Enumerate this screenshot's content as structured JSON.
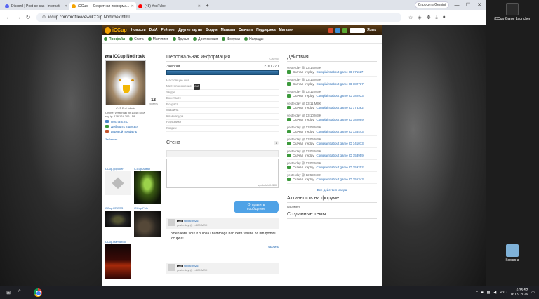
{
  "browser": {
    "tabs": [
      {
        "title": "Discord | Post-se-sas | Internati",
        "color": "#5865f2",
        "active": false
      },
      {
        "title": "iCCup — Секретная информа...",
        "color": "#f5a300",
        "active": true
      },
      {
        "title": "(48) YouTube",
        "color": "#ff0000",
        "active": false
      }
    ],
    "new_tab": "+",
    "gemini_label": "Спросить Gemini",
    "url": "iccup.com/profile/view/iCCup.Nodirbek.html"
  },
  "site": {
    "logo": "iCCup",
    "nav": [
      "Новости",
      "DotA",
      "Рейтинг",
      "Другие карты",
      "Форум",
      "Магазин",
      "Скачать",
      "Поддержка",
      "Магазин"
    ],
    "nav_right": {
      "lang": "Язык"
    },
    "subnav": [
      {
        "label": "Профайл",
        "active": true
      },
      {
        "label": "Стата",
        "active": false
      },
      {
        "label": "Матчлист",
        "active": false
      },
      {
        "label": "Друзья",
        "active": false
      },
      {
        "label": "Достижения",
        "active": false
      },
      {
        "label": "Форумы",
        "active": false
      },
      {
        "label": "Награды",
        "active": false
      }
    ]
  },
  "profile": {
    "username": "iCCup.Nodirbek",
    "tag": "CAT",
    "level_name": "CAT Full Admin",
    "rank": "12",
    "rank_label": "уровень",
    "last_online": "Online: yesterday @ 13:46 MSK",
    "reg_ip": "reg ip: 178.124.206.158",
    "links": {
      "message": "Послать ЛС",
      "add_friend": "Добавить в друзья",
      "game_profile": "Игровой профиль"
    },
    "ban_link": "Забанить"
  },
  "friends": [
    {
      "name": "iCCup.gopoker",
      "style": "heart"
    },
    {
      "name": "iCCup.Alisan",
      "style": "alien"
    },
    {
      "name": "iCCup.KROSS",
      "style": "dark"
    },
    {
      "name": "iCCup.Fols",
      "style": "smoke"
    },
    {
      "name": "iCCup.Hamtaroo",
      "style": "fire"
    }
  ],
  "personal": {
    "title": "Персональная информация",
    "status_label": "Статус",
    "energy_label": "Энергия",
    "energy_value": "270 / 270",
    "energy_fraction": 1.0,
    "fields": [
      "Настоящее имя",
      "Местоположение",
      "Skype",
      "Вконтакте",
      "Возраст",
      "Машина",
      "Клавиатура",
      "Наушники",
      "Коврик"
    ]
  },
  "wall": {
    "title": "Стена",
    "count": "1",
    "symbols": "symbols left: 300",
    "send_label": "Отправить сообщение",
    "posts": [
      {
        "author": "Umarx022",
        "tag": "CAT",
        "time": "yesterday @ 14:28 MSK",
        "text": "omen iewe squ! it nuiosa i hammaga ban berb tassha hc hm qomidi iccupda!",
        "delete": "удалить"
      },
      {
        "author": "Umarx022",
        "tag": "CAT",
        "time": "yesterday @ 14:25 MSK",
        "text": "",
        "delete": ""
      }
    ]
  },
  "actions": {
    "title": "Действия",
    "items": [
      {
        "time": "yesterday @ 13:14 MSK",
        "verb": "Скачал",
        "obj": "replay",
        "link": "Complaint about game ID 171127"
      },
      {
        "time": "yesterday @ 13:13 MSK",
        "verb": "Скачал",
        "obj": "replay",
        "link": "Complaint about game ID 182737"
      },
      {
        "time": "yesterday @ 13:12 MSK",
        "verb": "Скачал",
        "obj": "replay",
        "link": "Complaint about game ID 182933"
      },
      {
        "time": "yesterday @ 13:11 MSK",
        "verb": "Скачал",
        "obj": "replay",
        "link": "Complaint about game ID 176362"
      },
      {
        "time": "yesterday @ 13:10 MSK",
        "verb": "Скачал",
        "obj": "replay",
        "link": "Complaint about game ID 182099"
      },
      {
        "time": "yesterday @ 13:08 MSK",
        "verb": "Скачал",
        "obj": "replay",
        "link": "Complaint about game ID 136443"
      },
      {
        "time": "yesterday @ 13:05 MSK",
        "verb": "Скачал",
        "obj": "replay",
        "link": "Complaint about game ID 141073"
      },
      {
        "time": "yesterday @ 13:04 MSK",
        "verb": "Скачал",
        "obj": "replay",
        "link": "Complaint about game ID 153959"
      },
      {
        "time": "yesterday @ 13:02 MSK",
        "verb": "Скачал",
        "obj": "replay",
        "link": "Complaint about game ID 159202"
      },
      {
        "time": "yesterday @ 12:59 MSK",
        "verb": "Скачал",
        "obj": "replay",
        "link": "Complaint about game ID 155343"
      }
    ],
    "all_link": "Все действия юзера"
  },
  "forum": {
    "title": "Активность на форуме",
    "sub": "пасомен",
    "topics_title": "Созданные темы"
  },
  "desktop": {
    "icons": [
      {
        "label": "iCCup Game Launcher",
        "color": "#2b2b2b"
      },
      {
        "label": "Корзина",
        "color": "#7fb2d8"
      }
    ]
  },
  "taskbar": {
    "lang": "РУС",
    "time": "6:35:52",
    "date": "16.09.2026"
  }
}
